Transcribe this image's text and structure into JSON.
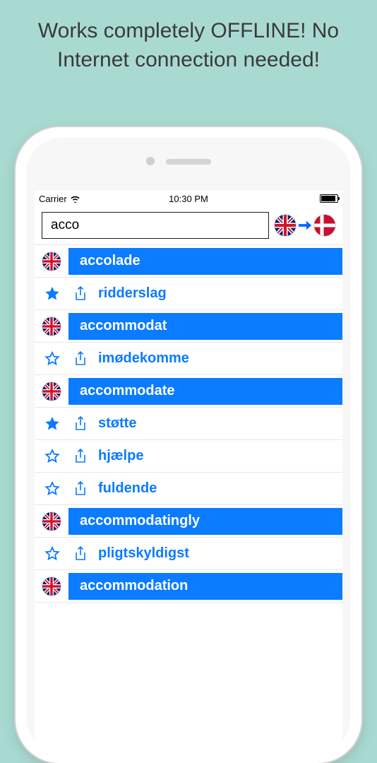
{
  "marketing": {
    "text": "Works completely OFFLINE! No Internet connection needed!"
  },
  "statusBar": {
    "carrier": "Carrier",
    "time": "10:30 PM"
  },
  "search": {
    "value": "acco"
  },
  "langPair": {
    "from": "uk",
    "to": "dk"
  },
  "rows": [
    {
      "type": "header",
      "flag": "uk",
      "label": "accolade"
    },
    {
      "type": "entry",
      "starred": true,
      "label": "ridderslag"
    },
    {
      "type": "header",
      "flag": "uk",
      "label": "accommodat"
    },
    {
      "type": "entry",
      "starred": false,
      "label": "imødekomme"
    },
    {
      "type": "header",
      "flag": "uk",
      "label": "accommodate"
    },
    {
      "type": "entry",
      "starred": true,
      "label": "støtte"
    },
    {
      "type": "entry",
      "starred": false,
      "label": "hjælpe"
    },
    {
      "type": "entry",
      "starred": false,
      "label": "fuldende"
    },
    {
      "type": "header",
      "flag": "uk",
      "label": "accommodatingly"
    },
    {
      "type": "entry",
      "starred": false,
      "label": "pligtskyldigst"
    },
    {
      "type": "header",
      "flag": "uk",
      "label": "accommodation"
    }
  ]
}
